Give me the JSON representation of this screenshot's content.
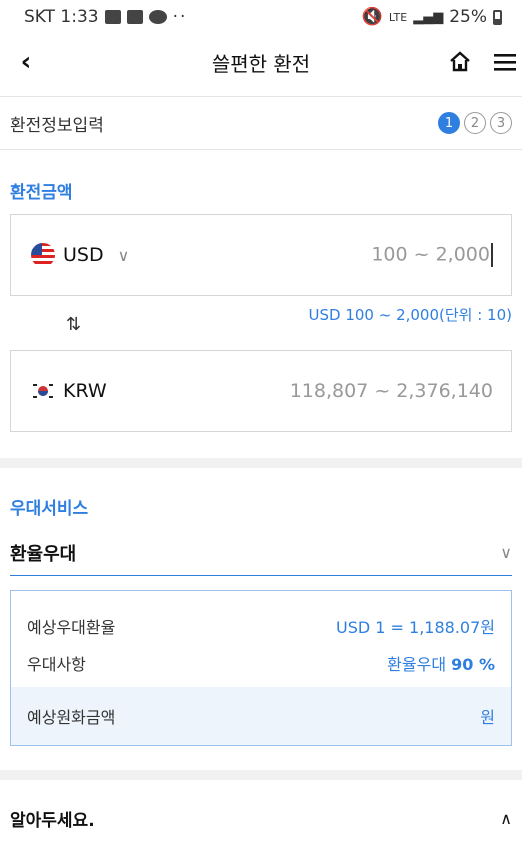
{
  "status_bar": {
    "carrier_time": "SKT 1:33",
    "dots": "··",
    "net": "LTE",
    "battery": "25%"
  },
  "nav": {
    "title": "쓸편한 환전"
  },
  "steps": {
    "label": "환전정보입력",
    "items": [
      "1",
      "2",
      "3"
    ],
    "active": 1
  },
  "exchange": {
    "section_title": "환전금액",
    "from": {
      "currency": "USD",
      "placeholder": "100 ~ 2,000"
    },
    "range_note": "USD 100 ~ 2,000(단위 : 10)",
    "to": {
      "currency": "KRW",
      "value": "118,807 ~ 2,376,140"
    }
  },
  "benefit": {
    "section_title": "우대서비스",
    "selected": "환율우대",
    "rows": [
      {
        "label": "예상우대환율",
        "value": "USD 1 = 1,188.07원"
      },
      {
        "label": "우대사항",
        "value_text": "환율우대 ",
        "value_bold": "90 %"
      },
      {
        "label": "예상원화금액",
        "value": "원"
      }
    ]
  },
  "notice": {
    "title": "알아두세요."
  },
  "colors": {
    "accent": "#2f7fe0"
  }
}
